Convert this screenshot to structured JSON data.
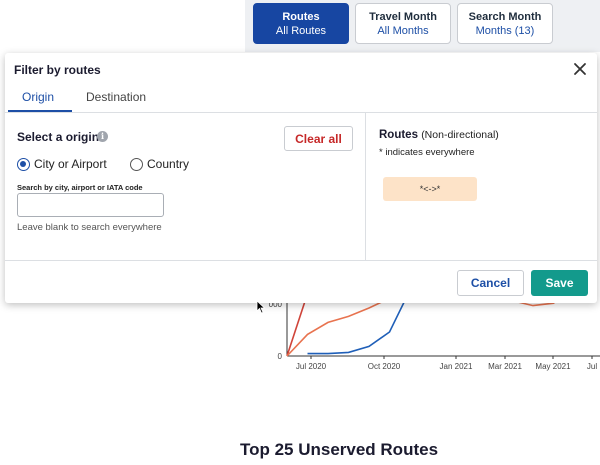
{
  "top_buttons": [
    {
      "title": "Routes",
      "value": "All Routes"
    },
    {
      "title": "Travel Month",
      "value": "All Months"
    },
    {
      "title": "Search Month",
      "value": "Months (13)"
    }
  ],
  "modal": {
    "title": "Filter by routes",
    "tabs": [
      "Origin",
      "Destination"
    ],
    "section_title": "Select a origin",
    "clear_label": "Clear all",
    "radio_city": "City or Airport",
    "radio_country": "Country",
    "search_label": "Search by city, airport or IATA code",
    "search_value": "",
    "hint": "Leave blank to search everywhere",
    "routes_title": "Routes",
    "routes_subtitle": "(Non-directional)",
    "routes_note": "* indicates everywhere",
    "route_chip": "*<->*",
    "cancel_label": "Cancel",
    "save_label": "Save"
  },
  "chart_data": {
    "type": "line",
    "x_ticks": [
      "Jul 2020",
      "Oct 2020",
      "Jan 2021",
      "Mar 2021",
      "May 2021",
      "Jul"
    ],
    "y_ticks": [
      "0",
      "000"
    ],
    "series": [
      {
        "color": "#d0443a",
        "points": [
          [
            0,
            0
          ],
          [
            1,
            52
          ]
        ]
      },
      {
        "color": "#e8734f",
        "points": [
          [
            0,
            0
          ],
          [
            1,
            18
          ],
          [
            2,
            28
          ],
          [
            3,
            33
          ],
          [
            4,
            40
          ],
          [
            5,
            48
          ],
          [
            6,
            54
          ],
          [
            10,
            54
          ],
          [
            11,
            46
          ],
          [
            12,
            42
          ],
          [
            13,
            44
          ],
          [
            14,
            58
          ],
          [
            15,
            60
          ]
        ]
      },
      {
        "color": "#1f5fb8",
        "points": [
          [
            1,
            2
          ],
          [
            2,
            2
          ],
          [
            3,
            3
          ],
          [
            4,
            8
          ],
          [
            5,
            20
          ],
          [
            6,
            55
          ],
          [
            7,
            60
          ],
          [
            14,
            54
          ],
          [
            15,
            60
          ]
        ]
      }
    ],
    "title": "Top 25 Unserved Routes",
    "colors": {
      "red": "#d0443a",
      "orange": "#e8734f",
      "blue": "#1f5fb8"
    }
  }
}
